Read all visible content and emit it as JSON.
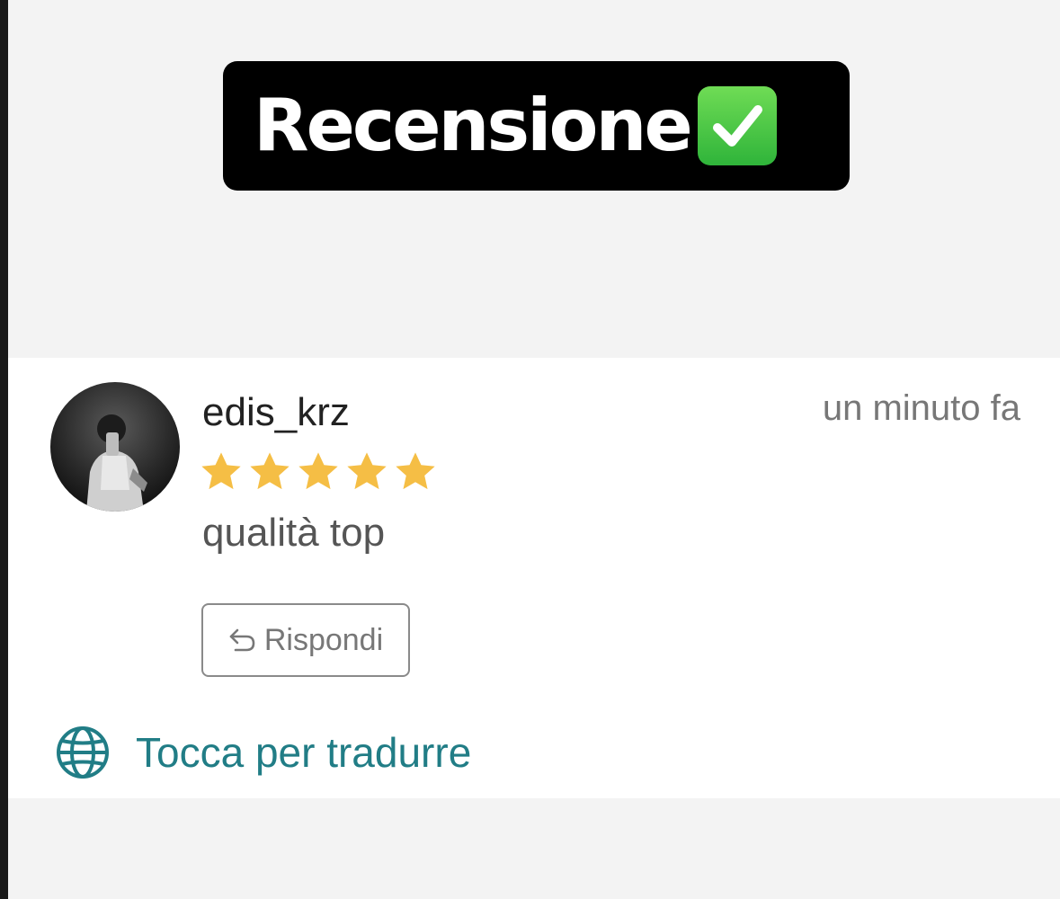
{
  "banner": {
    "title": "Recensione",
    "emoji_icon": "check-mark-button-icon",
    "emoji_color": "#3cc043"
  },
  "review": {
    "username": "edis_krz",
    "time": "un minuto fa",
    "rating": 5,
    "rating_max": 5,
    "star_color": "#f5be45",
    "text": "qualità top",
    "reply_label": "Rispondi",
    "translate_label": "Tocca per tradurre",
    "accent_color": "#217d86"
  }
}
